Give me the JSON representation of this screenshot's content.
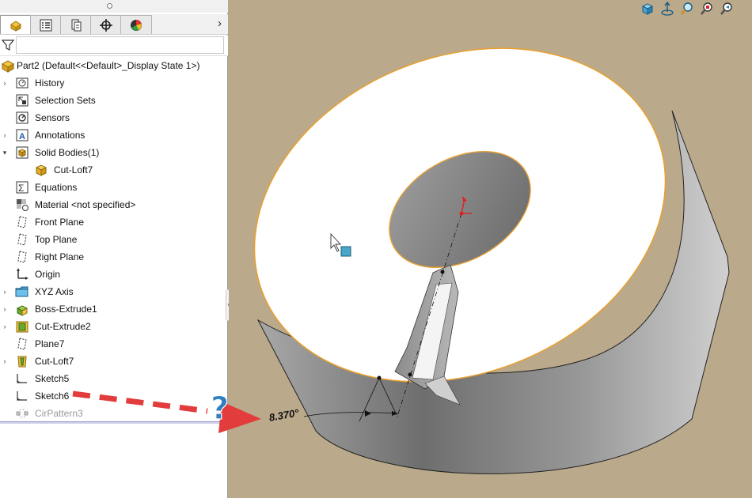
{
  "feature_tree": {
    "root": "Part2  (Default<<Default>_Display State 1>)",
    "items": [
      {
        "label": "History",
        "icon": "history-icon",
        "expandable": true
      },
      {
        "label": "Selection Sets",
        "icon": "selection-sets-icon",
        "expandable": false
      },
      {
        "label": "Sensors",
        "icon": "sensors-icon",
        "expandable": false
      },
      {
        "label": "Annotations",
        "icon": "annotations-icon",
        "expandable": true
      },
      {
        "label": "Solid Bodies(1)",
        "icon": "solid-bodies-icon",
        "expandable": true,
        "expanded": true
      },
      {
        "label": "Cut-Loft7",
        "icon": "body-icon",
        "expandable": false,
        "indent": 1
      },
      {
        "label": "Equations",
        "icon": "equations-icon",
        "expandable": false
      },
      {
        "label": "Material <not specified>",
        "icon": "material-icon",
        "expandable": false
      },
      {
        "label": "Front Plane",
        "icon": "plane-icon",
        "expandable": false
      },
      {
        "label": "Top Plane",
        "icon": "plane-icon",
        "expandable": false
      },
      {
        "label": "Right Plane",
        "icon": "plane-icon",
        "expandable": false
      },
      {
        "label": "Origin",
        "icon": "origin-icon",
        "expandable": false
      },
      {
        "label": "XYZ Axis",
        "icon": "folder-icon",
        "expandable": true
      },
      {
        "label": "Boss-Extrude1",
        "icon": "boss-extrude-icon",
        "expandable": true
      },
      {
        "label": "Cut-Extrude2",
        "icon": "cut-extrude-icon",
        "expandable": true
      },
      {
        "label": "Plane7",
        "icon": "plane-icon",
        "expandable": false
      },
      {
        "label": "Cut-Loft7",
        "icon": "cut-loft-icon",
        "expandable": true
      },
      {
        "label": "Sketch5",
        "icon": "sketch-icon",
        "expandable": false
      },
      {
        "label": "Sketch6",
        "icon": "sketch-icon",
        "expandable": false
      },
      {
        "label": "CirPattern3",
        "icon": "circular-pattern-icon",
        "expandable": false,
        "suppressed": true
      }
    ]
  },
  "tabs": [
    "feature-manager-icon",
    "property-manager-icon",
    "configuration-manager-icon",
    "dimxpert-icon",
    "display-manager-icon"
  ],
  "filter": {
    "value": "",
    "placeholder": ""
  },
  "viewport": {
    "dimension_text": "8.370°",
    "heads_up_tools": [
      "view-orientation-icon",
      "rotate-about-icon",
      "zoom-to-fit-icon",
      "zoom-to-area-icon",
      "previous-view-icon"
    ]
  },
  "colors": {
    "background": "#bba98b",
    "selection_edge": "#e8a030",
    "annotation_arrow": "#e23c3c",
    "question_mark": "#2f7fc1"
  }
}
